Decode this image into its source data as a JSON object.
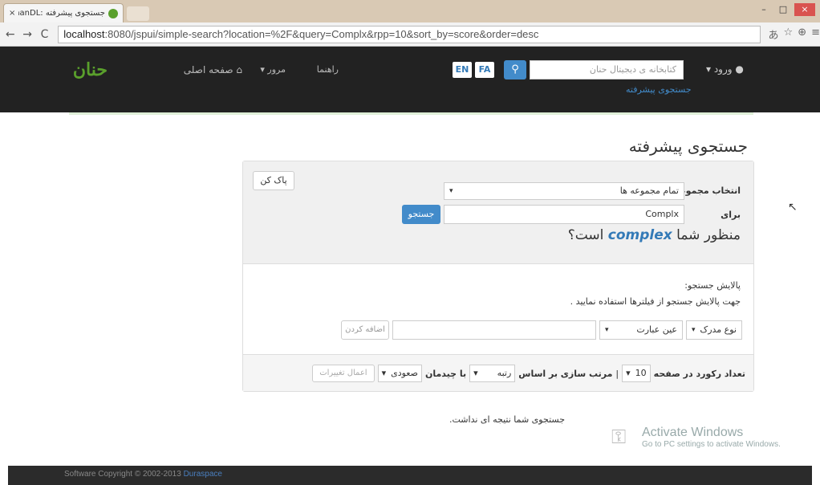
{
  "browser": {
    "tab_title": "جستجوی پیشرفته :HannanDL",
    "tab_close": "×",
    "url_host": "localhost",
    "url_rest": ":8080/jspui/simple-search?location=%2F&query=Complx&rpp=10&sort_by=score&order=desc",
    "win_min": "–",
    "win_max": "□",
    "win_close": "×"
  },
  "header": {
    "logo": "حنان",
    "home": "صفحه اصلی",
    "browse": "مرور ▾",
    "guide": "راهنما",
    "lang_en": "EN",
    "lang_fa": "FA",
    "search_placeholder": "کتابخانه ی دیجیتال حنان",
    "advanced_link": "جستجوی پیشرفته",
    "login": "ورود ▾"
  },
  "main": {
    "page_title": "جستجوی پیشرفته",
    "collection_label": "انتخاب مجموعه",
    "collection_value": "تمام مجموعه ها",
    "for_label": "برای",
    "query_value": "Complx",
    "search_button": "جستجو",
    "clear_button": "پاک کن",
    "did_you_mean_prefix": "منظور شما",
    "did_you_mean_term": "complex",
    "did_you_mean_suffix": "است؟"
  },
  "filter": {
    "title": "پالایش جستجو:",
    "help": "جهت پالایش جستجو از فیلترها استفاده نمایید .",
    "field_value": "نوع مدرک",
    "operator_value": "عین عبارت",
    "add_button": "اضافه کردن"
  },
  "results_settings": {
    "rpp_label": "تعداد رکورد در صفحه",
    "rpp_value": "10",
    "sort_label": "مرتب سازی بر اساس",
    "sort_value": "رتبه",
    "order_label": "با چیدمان",
    "order_value": "صعودی",
    "apply_button": "اعمال تغییرات"
  },
  "no_result": "جستجوی شما نتیجه ای نداشت.",
  "watermark": {
    "title": "Activate Windows",
    "subtitle": "Go to PC settings to activate Windows."
  },
  "footer": {
    "text": "Software Copyright © 2002-2013",
    "brand": "Duraspace"
  },
  "icons": {
    "back": "←",
    "forward": "→",
    "reload": "C",
    "search": "🔍",
    "home": "🏠",
    "user": "👤",
    "caret": "▾",
    "key": "🔑",
    "cursor": "↖"
  },
  "colors": {
    "navbar": "#222222",
    "primary": "#428bca",
    "brand_green": "#5aa02c"
  }
}
